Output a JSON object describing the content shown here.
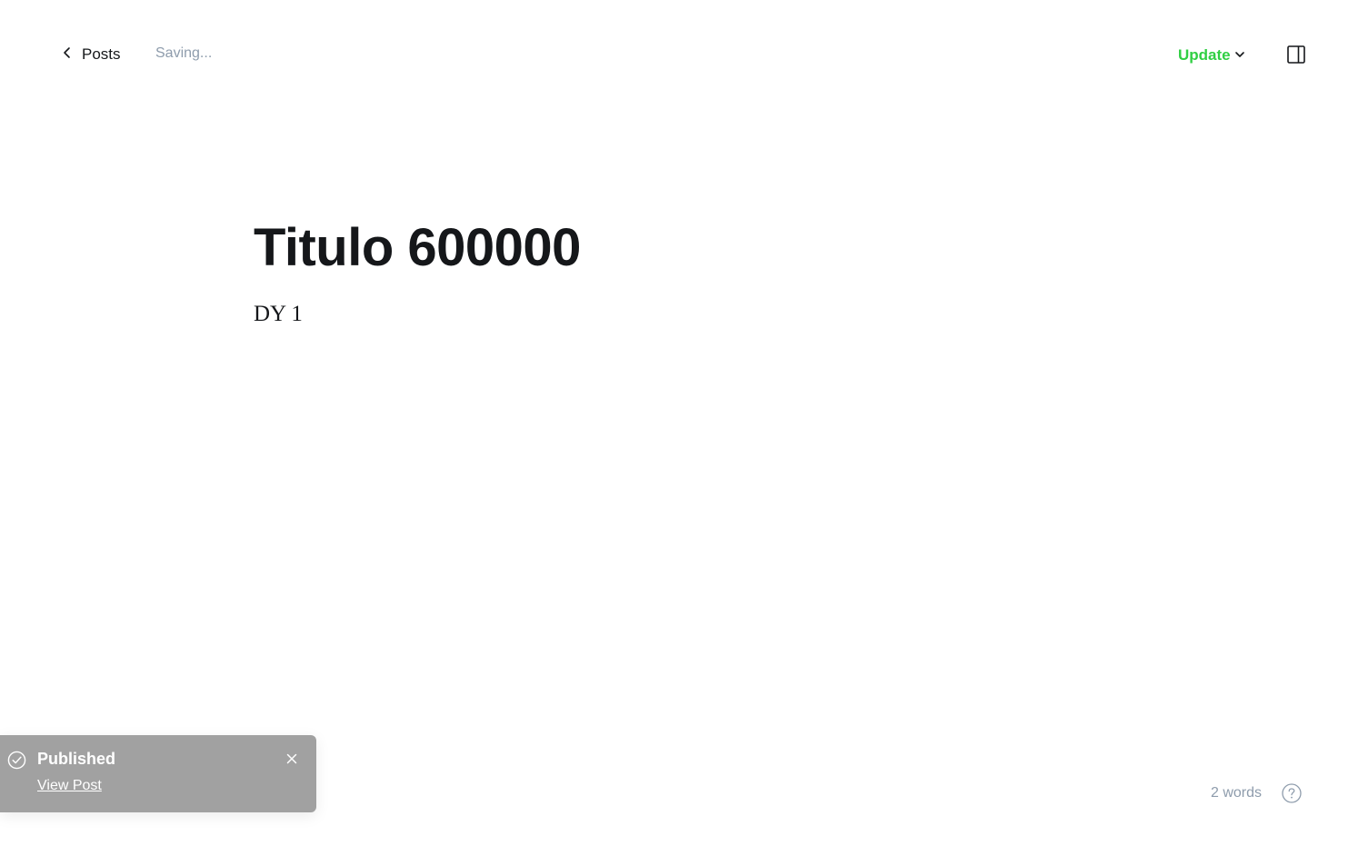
{
  "header": {
    "back_label": "Posts",
    "save_status": "Saving...",
    "update_label": "Update"
  },
  "editor": {
    "title": "Titulo 600000",
    "body": "DY 1"
  },
  "toast": {
    "title": "Published",
    "link_label": "View Post"
  },
  "footer": {
    "word_count": "2 words"
  },
  "icons": {
    "back": "chevron-left-icon",
    "update_dropdown": "chevron-down-icon",
    "sidebar_toggle": "sidebar-panel-icon",
    "toast_status": "check-circle-icon",
    "toast_close": "close-icon",
    "help": "question-circle-icon"
  },
  "colors": {
    "accent": "#30cf43",
    "text": "#15171a",
    "muted": "#8e9cac",
    "toast_bg": "#a1a1a1"
  }
}
